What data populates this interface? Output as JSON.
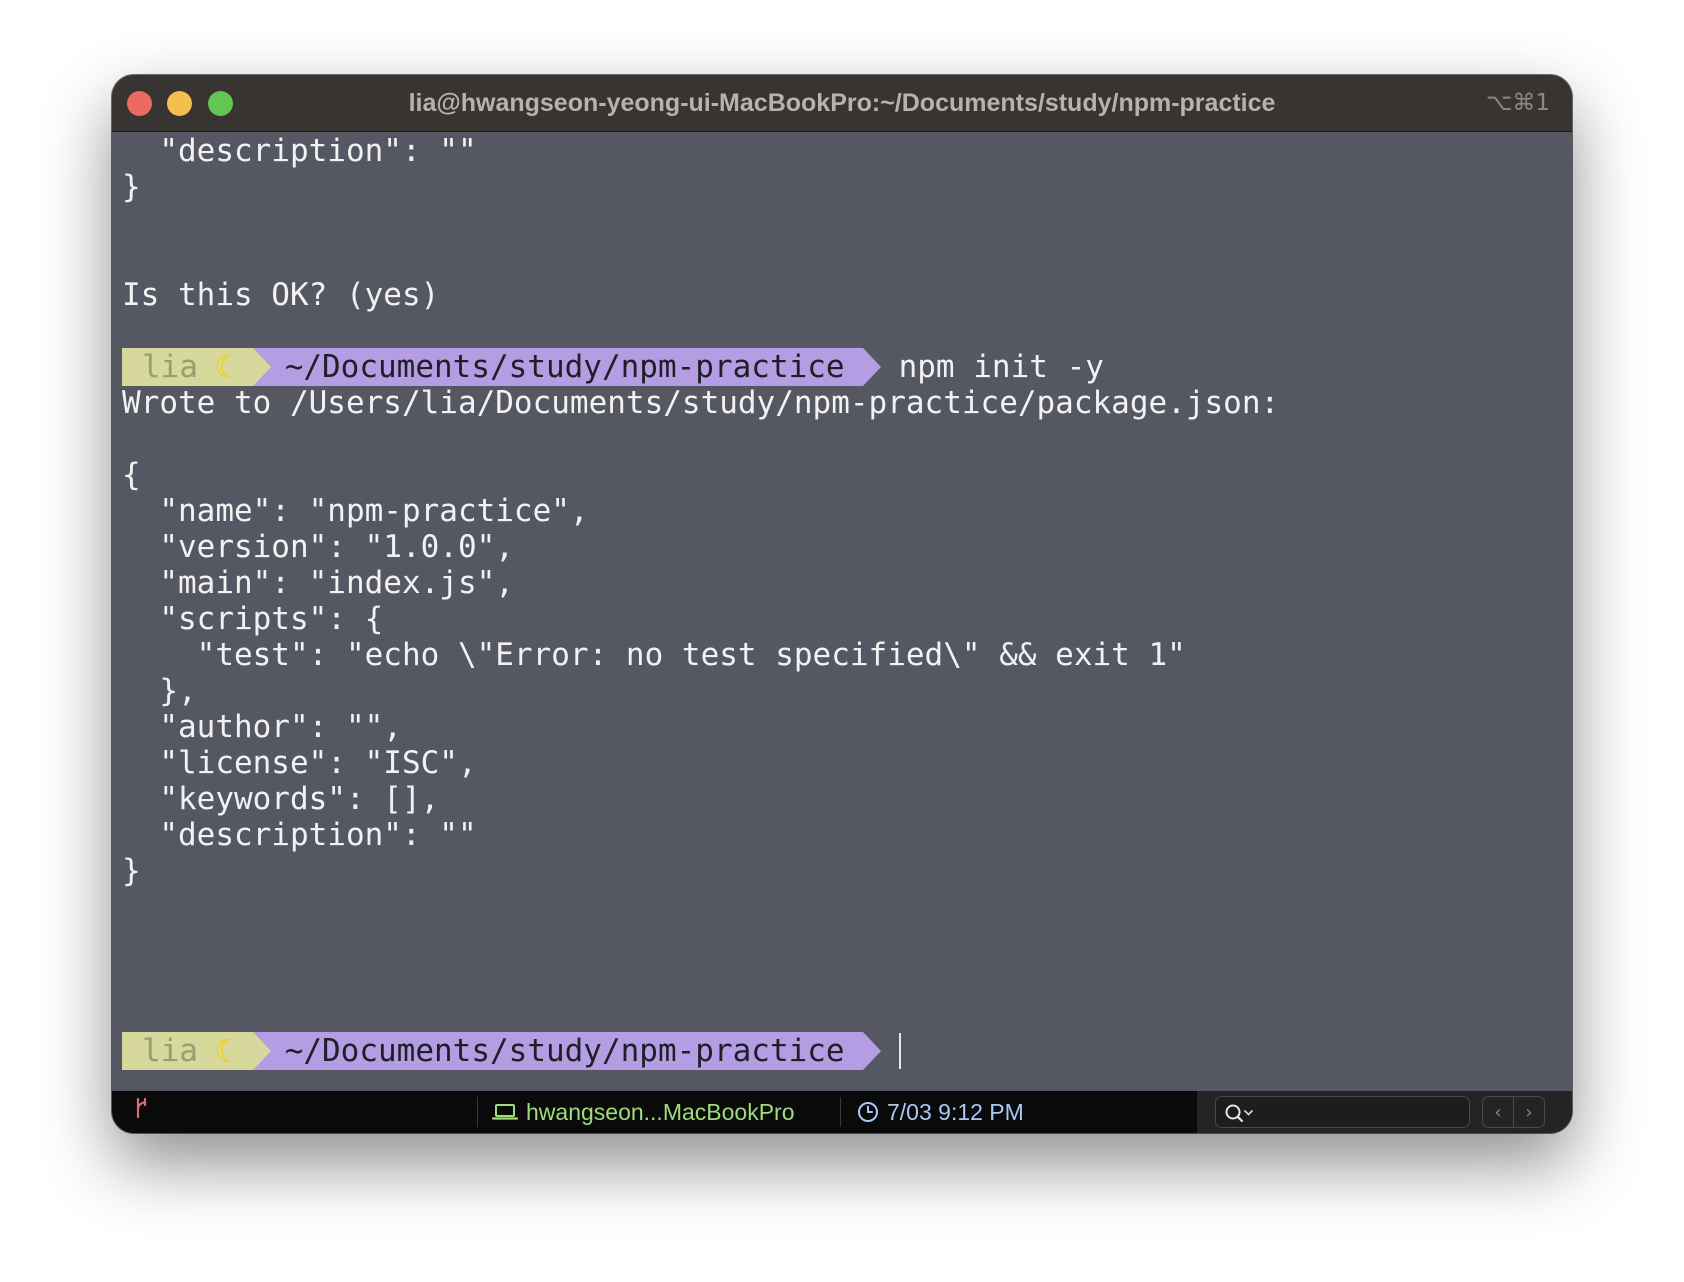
{
  "window": {
    "title": "lia@hwangseon-yeong-ui-MacBookPro:~/Documents/study/npm-practice",
    "shortcut": "⌥⌘1"
  },
  "terminal": {
    "lines_top": [
      "  \"description\": \"\"",
      "}",
      "",
      "",
      "Is this OK? (yes)",
      ""
    ],
    "prompt1": {
      "user": "lia",
      "path": "~/Documents/study/npm-practice",
      "command": "npm init -y"
    },
    "output": [
      "Wrote to /Users/lia/Documents/study/npm-practice/package.json:",
      "",
      "{",
      "  \"name\": \"npm-practice\",",
      "  \"version\": \"1.0.0\",",
      "  \"main\": \"index.js\",",
      "  \"scripts\": {",
      "    \"test\": \"echo \\\"Error: no test specified\\\" && exit 1\"",
      "  },",
      "  \"author\": \"\",",
      "  \"license\": \"ISC\",",
      "  \"keywords\": [],",
      "  \"description\": \"\"",
      "}"
    ],
    "prompt2": {
      "user": "lia",
      "path": "~/Documents/study/npm-practice",
      "command": ""
    }
  },
  "statusbar": {
    "host": "hwangseon...MacBookPro",
    "time": "7/03 9:12 PM",
    "colors": {
      "host": "#9fdc7c",
      "time": "#a9c8f4",
      "git": "#e06a6a"
    }
  },
  "prompt_colors": {
    "user_bg": "#d6d99b",
    "path_bg": "#b49de2",
    "terminal_bg": "#555862"
  }
}
